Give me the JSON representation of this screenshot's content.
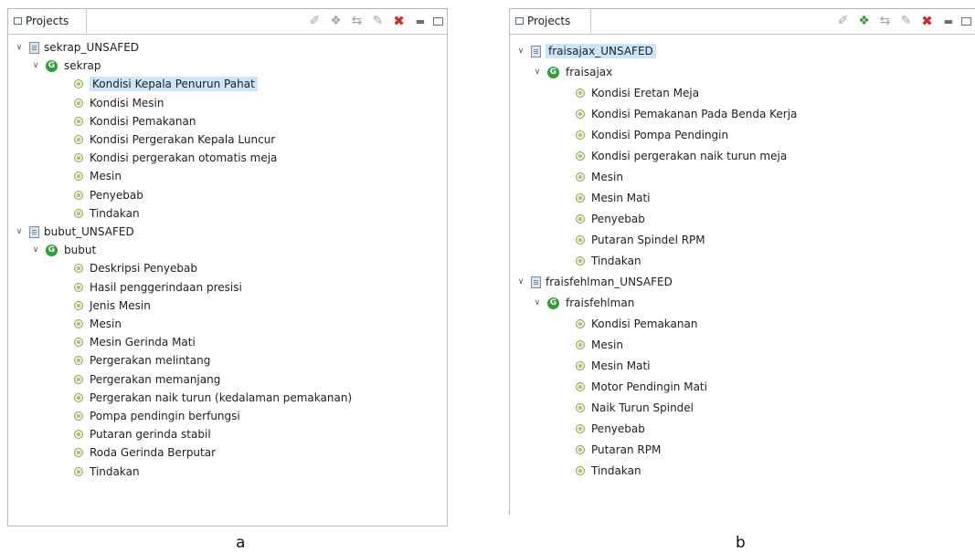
{
  "panels": [
    {
      "tab_label": "Projects",
      "caption": "a",
      "projects": [
        {
          "name": "sekrap_UNSAFED",
          "ontology": "sekrap",
          "classes": [
            "Kondisi Kepala Penurun Pahat",
            "Kondisi Mesin",
            "Kondisi Pemakanan",
            "Kondisi Pergerakan Kepala Luncur",
            "Kondisi pergerakan otomatis meja",
            "Mesin",
            "Penyebab",
            "Tindakan"
          ]
        },
        {
          "name": "bubut_UNSAFED",
          "ontology": "bubut",
          "classes": [
            "Deskripsi Penyebab",
            "Hasil penggerindaan presisi",
            "Jenis Mesin",
            "Mesin",
            "Mesin Gerinda Mati",
            "Pergerakan melintang",
            "Pergerakan memanjang",
            "Pergerakan naik turun (kedalaman pemakanan)",
            "Pompa pendingin berfungsi",
            "Putaran gerinda stabil",
            "Roda Gerinda Berputar",
            "Tindakan"
          ]
        }
      ],
      "selected": "Kondisi Kepala Penurun Pahat"
    },
    {
      "tab_label": "Projects",
      "caption": "b",
      "projects": [
        {
          "name": "fraisajax_UNSAFED",
          "ontology": "fraisajax",
          "classes": [
            "Kondisi Eretan Meja",
            "Kondisi Pemakanan Pada Benda Kerja",
            "Kondisi Pompa Pendingin",
            "Kondisi pergerakan naik turun meja",
            "Mesin",
            "Mesin Mati",
            "Penyebab",
            "Putaran Spindel  RPM",
            "Tindakan"
          ]
        },
        {
          "name": "fraisfehlman_UNSAFED",
          "ontology": "fraisfehlman",
          "classes": [
            "Kondisi Pemakanan",
            "Mesin",
            "Mesin Mati",
            "Motor Pendingin Mati",
            "Naik Turun Spindel",
            "Penyebab",
            "Putaran RPM",
            "Tindakan"
          ]
        }
      ],
      "selected": "fraisajax_UNSAFED"
    }
  ],
  "toolbar_icons": [
    "pin-icon",
    "new-ontology-icon",
    "refactor-icon",
    "edit-icon",
    "delete-icon",
    "minimize-icon",
    "maximize-icon"
  ],
  "colors": {
    "selection": "#cce5fa",
    "ontology_icon": "#2e9e3d",
    "delete_icon": "#d22a1e"
  }
}
